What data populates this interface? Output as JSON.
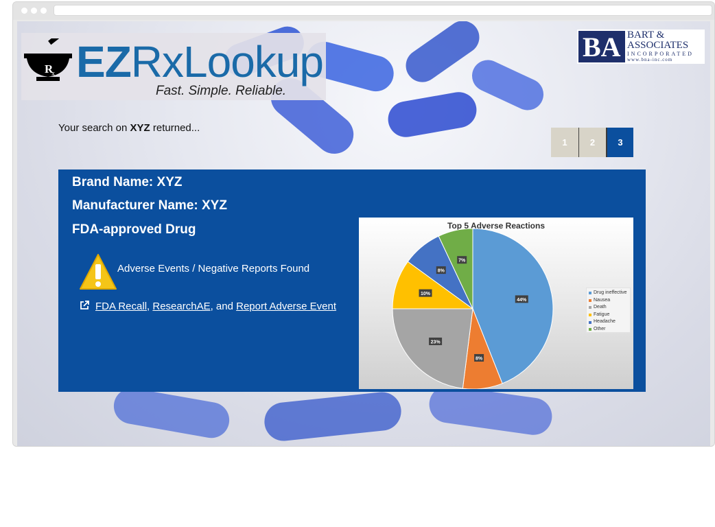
{
  "logo": {
    "part1": "EZ",
    "part2": "RxLookup",
    "tagline": "Fast. Simple. Reliable."
  },
  "partner": {
    "mark": "BA",
    "line1": "BART &",
    "line2": "ASSOCIATES",
    "line3": "INCORPORATED",
    "url": "www.bna-inc.com"
  },
  "search": {
    "prefix": "Your search on ",
    "term": "XYZ",
    "suffix": " returned..."
  },
  "pagination": {
    "pages": [
      "1",
      "2",
      "3"
    ],
    "active": "3"
  },
  "result": {
    "brand": "Brand Name: XYZ",
    "manufacturer": "Manufacturer Name: XYZ",
    "status": "FDA-approved Drug",
    "warning": "Adverse Events / Negative Reports Found",
    "links": {
      "link1": "FDA Recall",
      "sep1": ", ",
      "link2": "ResearchAE",
      "sep2": ", and ",
      "link3": "Report Adverse Event"
    }
  },
  "colors": {
    "panel": "#0b4f9e",
    "logo_blue": "#1a6aa8",
    "warning": "#f5c518"
  },
  "chart_data": {
    "type": "pie",
    "title": "Top 5 Adverse Reactions",
    "slices": [
      {
        "label": "Drug ineffective",
        "value": 44,
        "display": "44%",
        "color": "#5b9bd5"
      },
      {
        "label": "Nausea",
        "value": 8,
        "display": "8%",
        "color": "#ed7d31"
      },
      {
        "label": "Death",
        "value": 23,
        "display": "23%",
        "color": "#a5a5a5"
      },
      {
        "label": "Fatigue",
        "value": 10,
        "display": "10%",
        "color": "#ffc000"
      },
      {
        "label": "Headache",
        "value": 8,
        "display": "8%",
        "color": "#4472c4"
      },
      {
        "label": "Other",
        "value": 7,
        "display": "7%",
        "color": "#70ad47"
      }
    ],
    "legend_position": "right"
  }
}
